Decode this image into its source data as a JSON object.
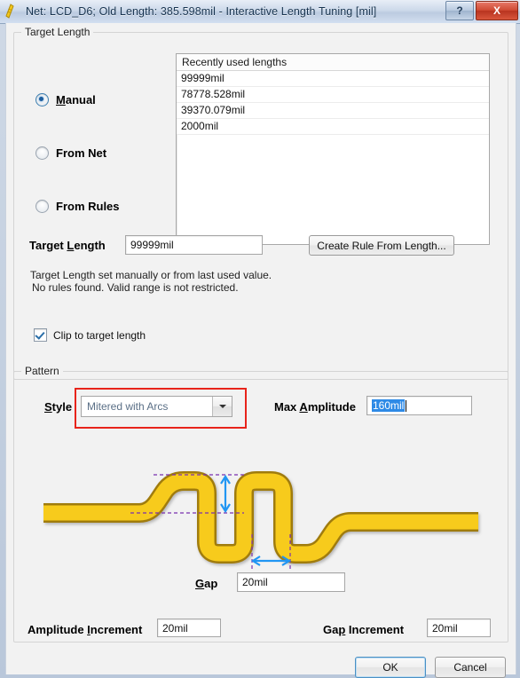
{
  "window": {
    "title": "Net: LCD_D6;  Old Length: 385.598mil -  Interactive Length Tuning [mil]",
    "help_label": "?",
    "close_label": "X",
    "icon": "length-tuning-icon"
  },
  "target_length_group": {
    "legend": "Target Length",
    "modes": [
      {
        "label_pre": "",
        "acc": "M",
        "label_post": "anual",
        "checked": true,
        "name": "manual"
      },
      {
        "label_pre": "From Net",
        "acc": "",
        "label_post": "",
        "checked": false,
        "name": "from-net"
      },
      {
        "label_pre": "From Rules",
        "acc": "",
        "label_post": "",
        "checked": false,
        "name": "from-rules"
      }
    ],
    "recent_list": {
      "header": "Recently used lengths",
      "items": [
        "99999mil",
        "78778.528mil",
        "39370.079mil",
        "2000mil"
      ]
    },
    "target_length_label_pre": "Target ",
    "target_length_label_acc": "L",
    "target_length_label_post": "ength",
    "target_length_value": "99999mil",
    "create_rule_button": "Create Rule From Length...",
    "note_line1": "Target Length set manually or from last used value.",
    "note_line2": "No rules found. Valid range is not restricted.",
    "clip_checkbox_label": "Clip to target length",
    "clip_checked": true
  },
  "pattern_group": {
    "legend": "Pattern",
    "style_label_pre": "",
    "style_label_acc": "S",
    "style_label_post": "tyle",
    "style_value": "Mitered with Arcs",
    "style_highlight_color": "#e8241b",
    "max_amplitude_label_pre": "Max ",
    "max_amplitude_label_acc": "A",
    "max_amplitude_label_post": "mplitude",
    "max_amplitude_value": "160mil",
    "max_amplitude_selected": true,
    "gap_label_pre": "",
    "gap_label_acc": "G",
    "gap_label_post": "ap",
    "gap_value": "20mil",
    "amplitude_increment_label_pre": "Amplitude ",
    "amplitude_increment_label_acc": "I",
    "amplitude_increment_label_post": "ncrement",
    "amplitude_increment_value": "20mil",
    "gap_increment_label_pre": "Ga",
    "gap_increment_label_acc": "p",
    "gap_increment_label_post": " Increment",
    "gap_increment_value": "20mil",
    "diagram": {
      "trace_fill": "#f5c518",
      "trace_stroke": "#9c7a10",
      "dashed_color": "#7a2fb0",
      "arrow_color": "#2196f3",
      "amplitude_arrow": "vertical-double-arrow",
      "gap_arrow": "horizontal-double-arrow"
    }
  },
  "footer": {
    "ok_label": "OK",
    "cancel_label": "Cancel"
  }
}
